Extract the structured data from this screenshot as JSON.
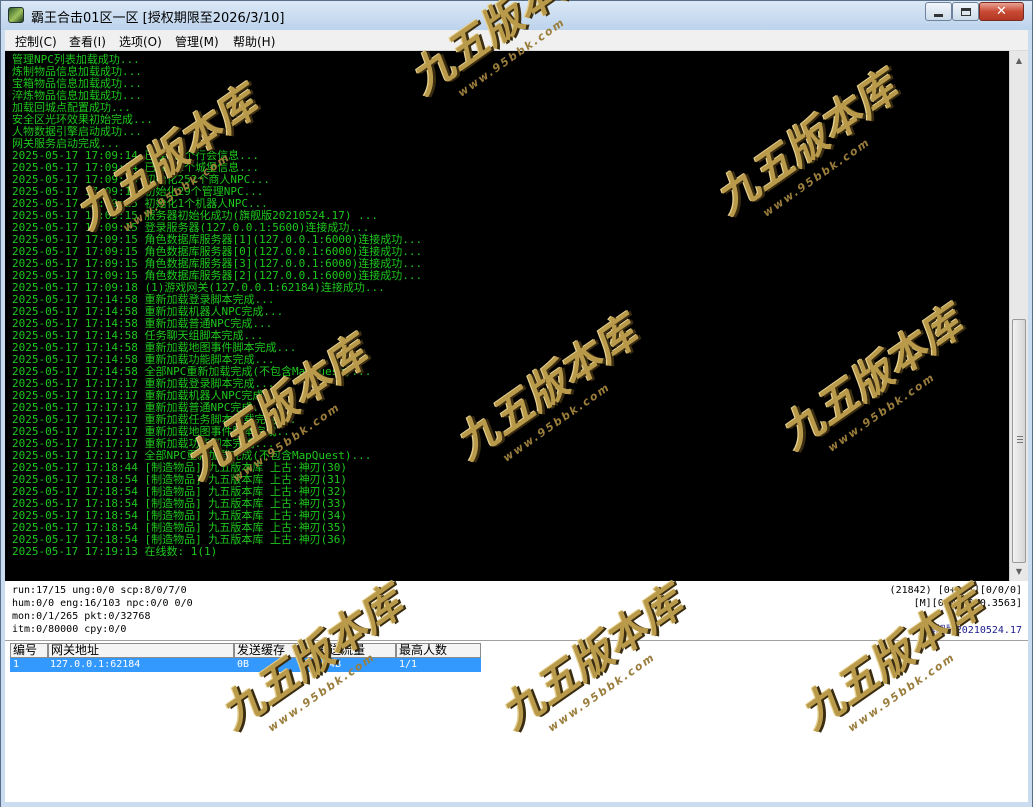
{
  "window": {
    "title": "霸王合击01区一区 [授权期限至2026/3/10]"
  },
  "menu": [
    {
      "label": "控制(C)"
    },
    {
      "label": "查看(I)"
    },
    {
      "label": "选项(O)"
    },
    {
      "label": "管理(M)"
    },
    {
      "label": "帮助(H)"
    }
  ],
  "log": [
    "管理NPC列表加载成功...",
    "炼制物品信息加载成功...",
    "宝箱物品信息加载成功...",
    "淬炼物品信息加载成功...",
    "加载回城点配置成功...",
    "安全区光环效果初始完成...",
    "人物数据引擎启动成功...",
    "网关服务启动完成...",
    "2025-05-17 17:09:14 已读取0个行会信息...",
    "2025-05-17 17:09:14 已读取1个城堡信息...",
    "2025-05-17 17:09:15 初始化252个商人NPC...",
    "2025-05-17 17:09:15 初始化29个管理NPC...",
    "2025-05-17 17:09:15 初始化1个机器人NPC...",
    "2025-05-17 17:09:15 服务器初始化成功(旗舰版20210524.17) ...",
    "2025-05-17 17:09:15 登录服务器(127.0.0.1:5600)连接成功...",
    "2025-05-17 17:09:15 角色数据库服务器[1](127.0.0.1:6000)连接成功...",
    "2025-05-17 17:09:15 角色数据库服务器[0](127.0.0.1:6000)连接成功...",
    "2025-05-17 17:09:15 角色数据库服务器[3](127.0.0.1:6000)连接成功...",
    "2025-05-17 17:09:15 角色数据库服务器[2](127.0.0.1:6000)连接成功...",
    "2025-05-17 17:09:18 (1)游戏网关(127.0.0.1:62184)连接成功...",
    "2025-05-17 17:14:58 重新加载登录脚本完成...",
    "2025-05-17 17:14:58 重新加载机器人NPC完成...",
    "2025-05-17 17:14:58 重新加载普通NPC完成...",
    "2025-05-17 17:14:58 任务聊天组脚本完成...",
    "2025-05-17 17:14:58 重新加载地图事件脚本完成...",
    "2025-05-17 17:14:58 重新加载功能脚本完成...",
    "2025-05-17 17:14:58 全部NPC重新加载完成(不包含MapQuest)...",
    "2025-05-17 17:17:17 重新加载登录脚本完成...",
    "2025-05-17 17:17:17 重新加载机器人NPC完成...",
    "2025-05-17 17:17:17 重新加载普通NPC完成...",
    "2025-05-17 17:17:17 重新加载任务脚本加载完成...",
    "2025-05-17 17:17:17 重新加载地图事件脚本完成...",
    "2025-05-17 17:17:17 重新加载功能脚本完成...",
    "2025-05-17 17:17:17 全部NPC重新加载完成(不包含MapQuest)...",
    "2025-05-17 17:18:44 [制造物品] 九五版本库 上古·神刃(30)",
    "2025-05-17 17:18:54 [制造物品] 九五版本库 上古·神刃(31)",
    "2025-05-17 17:18:54 [制造物品] 九五版本库 上古·神刃(32)",
    "2025-05-17 17:18:54 [制造物品] 九五版本库 上古·神刃(33)",
    "2025-05-17 17:18:54 [制造物品] 九五版本库 上古·神刃(34)",
    "2025-05-17 17:18:54 [制造物品] 九五版本库 上古·神刃(35)",
    "2025-05-17 17:18:54 [制造物品] 九五版本库 上古·神刃(36)",
    "2025-05-17 17:19:13 在线数: 1(1)"
  ],
  "status": {
    "left": [
      "run:17/15 ung:0/0 scp:8/0/7/0",
      "hum:0/0 eng:16/103 npc:0/0 0/0",
      "mon:0/1/265 pkt:0/32768",
      "itm:0/80000 cpy:0/0"
    ],
    "right_1": "(21842) [0+1/1][0/0/0]",
    "right_2": "[M][0:0:19/0.3563]",
    "version": "旗舰版20210524.17"
  },
  "gateways": {
    "columns": [
      "编号",
      "网关地址",
      "发送缓存",
      "发送流量",
      "最高人数"
    ],
    "rows": [
      {
        "id": "1",
        "address": "127.0.0.1:62184",
        "send_cache": "0B",
        "send_traffic": "144B",
        "max_users": "1/1"
      }
    ]
  },
  "watermark": {
    "text": "九五版本库",
    "url": "www.95bbk.com"
  },
  "colors": {
    "log_text": "#1ec81e",
    "log_bg": "#000000",
    "selection": "#3399ff",
    "version_text": "#1a1a8c"
  }
}
